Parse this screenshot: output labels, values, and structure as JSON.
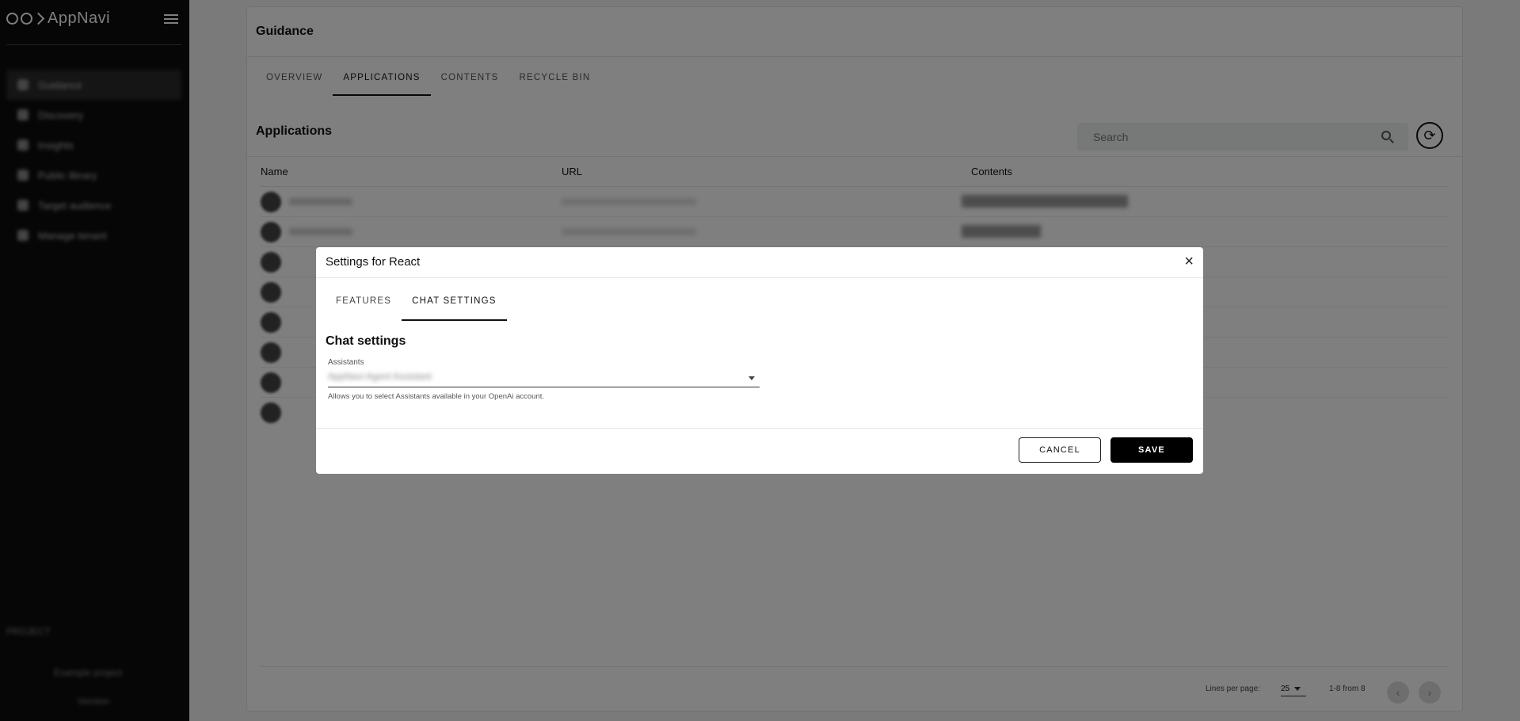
{
  "app": {
    "brand": "AppNavi",
    "nav_items": [
      "Guidance",
      "Discovery",
      "Insights",
      "Public library",
      "Target audience",
      "Manage tenant"
    ],
    "bottom": {
      "section": "PROJECT",
      "project": "Example project",
      "footer": "Version"
    }
  },
  "page": {
    "title": "Guidance",
    "tabs": [
      "OVERVIEW",
      "APPLICATIONS",
      "CONTENTS",
      "RECYCLE BIN"
    ],
    "active_tab": "APPLICATIONS",
    "section_title": "Applications",
    "search_placeholder": "Search",
    "table": {
      "headers": [
        "Name",
        "URL",
        "Contents"
      ],
      "row_count": 8
    },
    "pager": {
      "lines_per_page_label": "Lines per page:",
      "lines_per_page": "25",
      "range": "1-8 from 8"
    }
  },
  "modal": {
    "title": "Settings for React",
    "close_icon": "×",
    "tabs": [
      "FEATURES",
      "CHAT SETTINGS"
    ],
    "active_tab": "CHAT SETTINGS",
    "section_title": "Chat settings",
    "field_label": "Assistants",
    "field_value": "AppNavi Agent Assistant",
    "helper": "Allows you to select Assistants available in your OpenAi account.",
    "cancel_label": "CANCEL",
    "save_label": "SAVE"
  }
}
